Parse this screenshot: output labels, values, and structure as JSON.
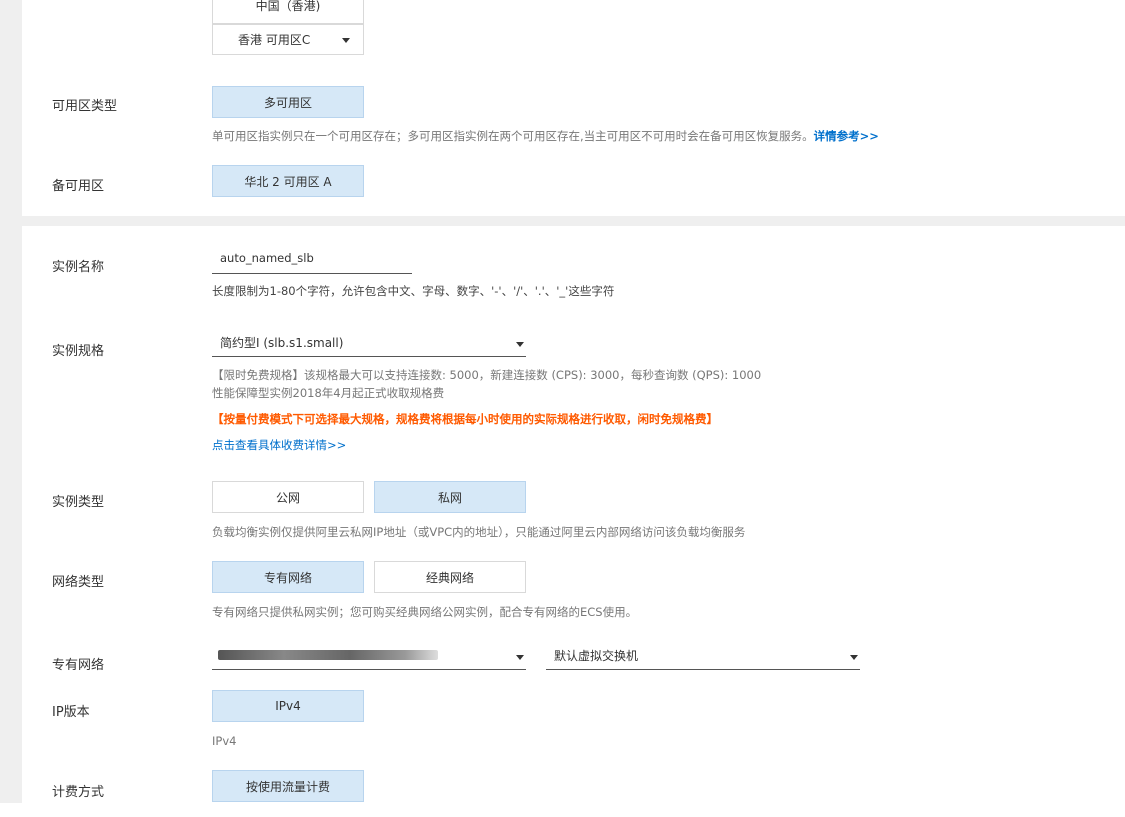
{
  "region": {
    "region_value": "中国（香港)",
    "zone_value": "香港 可用区C"
  },
  "zone_type": {
    "label": "可用区类型",
    "option": "多可用区",
    "note": "单可用区指实例只在一个可用区存在；多可用区指实例在两个可用区存在,当主可用区不可用时会在备可用区恢复服务。",
    "note_link": "详情参考>>"
  },
  "backup_zone": {
    "label": "备可用区",
    "option": "华北 2 可用区 A"
  },
  "instance_name": {
    "label": "实例名称",
    "value": "auto_named_slb",
    "note": "长度限制为1-80个字符，允许包含中文、字母、数字、'-'、'/'、'.'、'_'这些字符"
  },
  "instance_spec": {
    "label": "实例规格",
    "value": "简约型I (slb.s1.small)",
    "note_line1": "【限时免费规格】该规格最大可以支持连接数: 5000，新建连接数 (CPS): 3000，每秒查询数 (QPS): 1000",
    "note_line2": "性能保障型实例2018年4月起正式收取规格费",
    "warning": "【按量付费模式下可选择最大规格，规格费将根据每小时使用的实际规格进行收取，闲时免规格费】",
    "pricing_link": "点击查看具体收费详情>>"
  },
  "instance_type": {
    "label": "实例类型",
    "options": [
      "公网",
      "私网"
    ],
    "selected": "私网",
    "note": "负载均衡实例仅提供阿里云私网IP地址（或VPC内的地址），只能通过阿里云内部网络访问该负载均衡服务"
  },
  "network_type": {
    "label": "网络类型",
    "options": [
      "专有网络",
      "经典网络"
    ],
    "selected": "专有网络",
    "note": "专有网络只提供私网实例；您可购买经典网络公网实例，配合专有网络的ECS使用。"
  },
  "vpc": {
    "label": "专有网络",
    "vswitch_value": "默认虚拟交换机"
  },
  "ip_version": {
    "label": "IP版本",
    "option": "IPv4",
    "note": "IPv4"
  },
  "billing": {
    "label": "计费方式",
    "option": "按使用流量计费"
  },
  "colors": {
    "selected_bg": "#d6e8f7",
    "link": "#0070cc",
    "warning": "#ff5a00",
    "page_bg": "#efefef"
  }
}
